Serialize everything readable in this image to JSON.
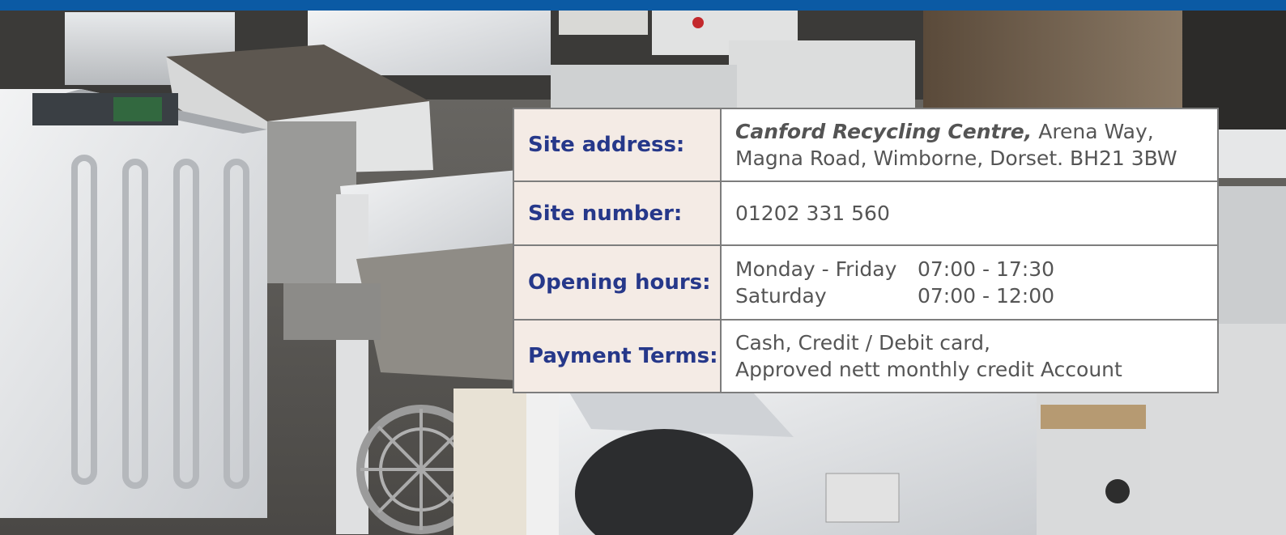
{
  "site_info": {
    "address": {
      "label": "Site address:",
      "name": "Canford Recycling Centre,",
      "line1_rest": " Arena Way,",
      "line2": "Magna Road, Wimborne, Dorset. BH21 3BW"
    },
    "number": {
      "label": "Site number:",
      "value": "01202 331 560"
    },
    "hours": {
      "label": "Opening hours:",
      "rows": [
        {
          "day": "Monday - Friday",
          "time": "07:00 - 17:30"
        },
        {
          "day": "Saturday",
          "time": "07:00 - 12:00"
        }
      ]
    },
    "payment": {
      "label": "Payment Terms:",
      "line1": "Cash, Credit / Debit card,",
      "line2": "Approved nett monthly credit Account"
    }
  },
  "colors": {
    "top_bar": "#0b5aa4",
    "label_text": "#26388a",
    "label_bg": "#f4ebe5",
    "value_text": "#555555",
    "border": "#7d7d7d"
  },
  "background_image": "scrap washing machines and white goods at a recycling yard"
}
